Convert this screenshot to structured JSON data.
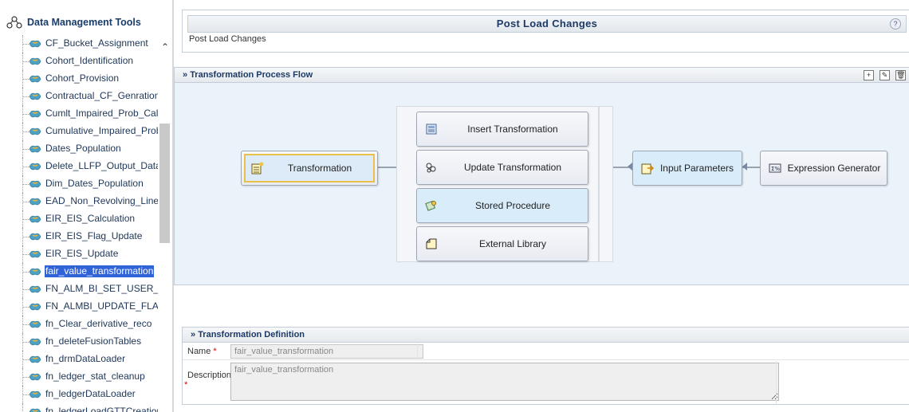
{
  "sidebar": {
    "title": "Data Management Tools",
    "items": [
      {
        "label": "CF_Bucket_Assignment"
      },
      {
        "label": "Cohort_Identification"
      },
      {
        "label": "Cohort_Provision"
      },
      {
        "label": "Contractual_CF_Genration"
      },
      {
        "label": "Cumlt_Impaired_Prob_Calc"
      },
      {
        "label": "Cumulative_Impaired_Prob_"
      },
      {
        "label": "Dates_Population"
      },
      {
        "label": "Delete_LLFP_Output_Data"
      },
      {
        "label": "Dim_Dates_Population"
      },
      {
        "label": "EAD_Non_Revolving_Lines"
      },
      {
        "label": "EIR_EIS_Calculation"
      },
      {
        "label": "EIR_EIS_Flag_Update"
      },
      {
        "label": "EIR_EIS_Update"
      },
      {
        "label": "fair_value_transformation"
      },
      {
        "label": "FN_ALM_BI_SET_USER_D"
      },
      {
        "label": "FN_ALMBI_UPDATE_FLAT_"
      },
      {
        "label": "fn_Clear_derivative_reco"
      },
      {
        "label": "fn_deleteFusionTables"
      },
      {
        "label": "fn_drmDataLoader"
      },
      {
        "label": "fn_ledger_stat_cleanup"
      },
      {
        "label": "fn_ledgerDataLoader"
      },
      {
        "label": "fn_ledgerLoadGTTCreation"
      }
    ],
    "selected_index": 13
  },
  "header": {
    "title": "Post Load Changes",
    "subtitle": "Post Load Changes"
  },
  "flow": {
    "title": "Transformation Process Flow",
    "toolbar_icons": [
      "add-icon",
      "edit-icon",
      "delete-icon"
    ],
    "transformation": "Transformation",
    "insert": "Insert Transformation",
    "update": "Update Transformation",
    "stored": "Stored Procedure",
    "external": "External Library",
    "input_params": "Input Parameters",
    "expression": "Expression Generator"
  },
  "definition": {
    "title": "Transformation Definition",
    "name_label": "Name",
    "name_value": "fair_value_transformation",
    "desc_label": "Description",
    "desc_value": "fair_value_transformation",
    "required_mark": "*"
  },
  "colors": {
    "selection": "#3163d8",
    "panel_bg": "#eaf2fa",
    "highlight_box": "#d9ecfa",
    "title_text": "#1d3a66"
  }
}
